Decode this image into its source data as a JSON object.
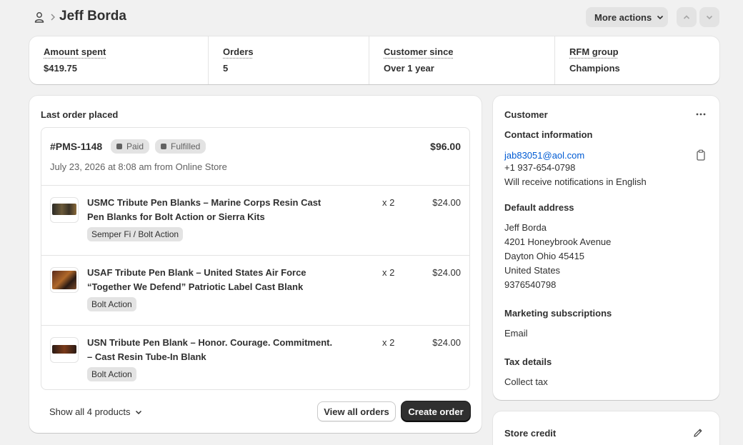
{
  "header": {
    "title": "Jeff Borda",
    "more_actions_label": "More actions"
  },
  "stats": [
    {
      "label": "Amount spent",
      "value": "$419.75"
    },
    {
      "label": "Orders",
      "value": "5"
    },
    {
      "label": "Customer since",
      "value": "Over 1 year"
    },
    {
      "label": "RFM group",
      "value": "Champions"
    }
  ],
  "last_order": {
    "section_title": "Last order placed",
    "number": "#PMS-1148",
    "badges": [
      "Paid",
      "Fulfilled"
    ],
    "total": "$96.00",
    "date": "July 23, 2026 at 8:08 am from Online Store",
    "items": [
      {
        "title": "USMC Tribute Pen Blanks – Marine Corps Resin Cast Pen Blanks for Bolt Action or Sierra Kits",
        "variant": "Semper Fi / Bolt Action",
        "qty": "x 2",
        "price": "$24.00"
      },
      {
        "title": "USAF Tribute Pen Blank – United States Air Force “Together We Defend” Patriotic Label Cast Blank",
        "variant": "Bolt Action",
        "qty": "x 2",
        "price": "$24.00"
      },
      {
        "title": "USN Tribute Pen Blank – Honor. Courage. Commitment. – Cast Resin Tube-In Blank",
        "variant": "Bolt Action",
        "qty": "x 2",
        "price": "$24.00"
      }
    ],
    "show_all_label": "Show all 4 products",
    "view_all_label": "View all orders",
    "create_label": "Create order"
  },
  "customer": {
    "title": "Customer",
    "contact_heading": "Contact information",
    "email": "jab83051@aol.com",
    "phone": "+1 937-654-0798",
    "notifications": "Will receive notifications in English",
    "address_heading": "Default address",
    "address_lines": [
      "Jeff Borda",
      "4201 Honeybrook Avenue",
      "Dayton Ohio 45415",
      "United States",
      "9376540798"
    ],
    "marketing_heading": "Marketing subscriptions",
    "marketing_value": "Email",
    "tax_heading": "Tax details",
    "tax_value": "Collect tax"
  },
  "store_credit": {
    "title": "Store credit"
  },
  "colors": {
    "background": "#f1f1f1",
    "card": "#ffffff",
    "primary_button": "#303030",
    "link": "#005bd3",
    "badge": "#e3e3e3"
  },
  "icons": [
    "person-icon",
    "chevron-right-icon",
    "chevron-down-icon",
    "chevron-up-icon",
    "ellipsis-icon",
    "clipboard-icon",
    "pencil-icon"
  ]
}
